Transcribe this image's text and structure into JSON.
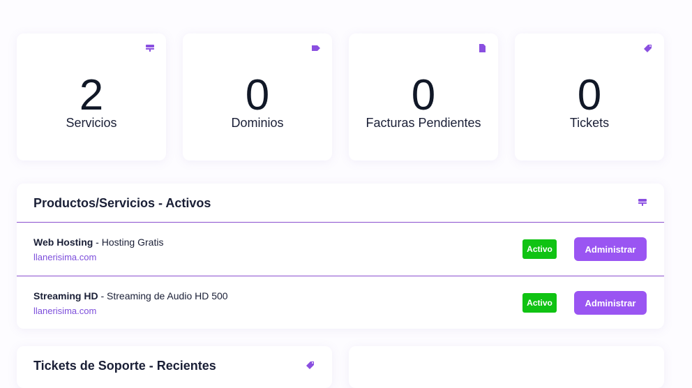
{
  "stats": [
    {
      "value": "2",
      "label": "Servicios",
      "icon": "server-icon"
    },
    {
      "value": "0",
      "label": "Dominios",
      "icon": "tag-icon"
    },
    {
      "value": "0",
      "label": "Facturas Pendientes",
      "icon": "file-icon"
    },
    {
      "value": "0",
      "label": "Tickets",
      "icon": "ticket-icon"
    }
  ],
  "services_panel": {
    "title": "Productos/Servicios - Activos",
    "icon": "server-icon",
    "rows": [
      {
        "product": "Web Hosting",
        "separator": " - ",
        "plan": "Hosting Gratis",
        "domain": "llanerisima.com",
        "status": "Activo",
        "action": "Administrar"
      },
      {
        "product": "Streaming HD",
        "separator": " - ",
        "plan": "Streaming de Audio HD 500",
        "domain": "llanerisima.com",
        "status": "Activo",
        "action": "Administrar"
      }
    ]
  },
  "tickets_panel": {
    "title": "Tickets de Soporte - Recientes",
    "icon": "ticket-icon"
  },
  "colors": {
    "accent": "#9a55f2",
    "status_active": "#10c313",
    "link": "#7c4ddb"
  }
}
